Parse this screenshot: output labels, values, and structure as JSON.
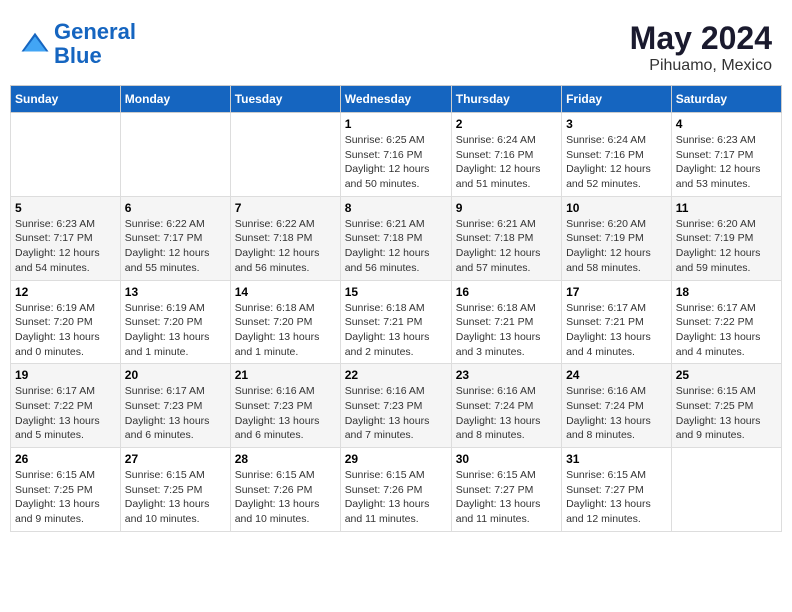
{
  "header": {
    "logo_line1": "General",
    "logo_line2": "Blue",
    "month_year": "May 2024",
    "location": "Pihuamo, Mexico"
  },
  "weekdays": [
    "Sunday",
    "Monday",
    "Tuesday",
    "Wednesday",
    "Thursday",
    "Friday",
    "Saturday"
  ],
  "weeks": [
    [
      {
        "day": "",
        "info": ""
      },
      {
        "day": "",
        "info": ""
      },
      {
        "day": "",
        "info": ""
      },
      {
        "day": "1",
        "info": "Sunrise: 6:25 AM\nSunset: 7:16 PM\nDaylight: 12 hours\nand 50 minutes."
      },
      {
        "day": "2",
        "info": "Sunrise: 6:24 AM\nSunset: 7:16 PM\nDaylight: 12 hours\nand 51 minutes."
      },
      {
        "day": "3",
        "info": "Sunrise: 6:24 AM\nSunset: 7:16 PM\nDaylight: 12 hours\nand 52 minutes."
      },
      {
        "day": "4",
        "info": "Sunrise: 6:23 AM\nSunset: 7:17 PM\nDaylight: 12 hours\nand 53 minutes."
      }
    ],
    [
      {
        "day": "5",
        "info": "Sunrise: 6:23 AM\nSunset: 7:17 PM\nDaylight: 12 hours\nand 54 minutes."
      },
      {
        "day": "6",
        "info": "Sunrise: 6:22 AM\nSunset: 7:17 PM\nDaylight: 12 hours\nand 55 minutes."
      },
      {
        "day": "7",
        "info": "Sunrise: 6:22 AM\nSunset: 7:18 PM\nDaylight: 12 hours\nand 56 minutes."
      },
      {
        "day": "8",
        "info": "Sunrise: 6:21 AM\nSunset: 7:18 PM\nDaylight: 12 hours\nand 56 minutes."
      },
      {
        "day": "9",
        "info": "Sunrise: 6:21 AM\nSunset: 7:18 PM\nDaylight: 12 hours\nand 57 minutes."
      },
      {
        "day": "10",
        "info": "Sunrise: 6:20 AM\nSunset: 7:19 PM\nDaylight: 12 hours\nand 58 minutes."
      },
      {
        "day": "11",
        "info": "Sunrise: 6:20 AM\nSunset: 7:19 PM\nDaylight: 12 hours\nand 59 minutes."
      }
    ],
    [
      {
        "day": "12",
        "info": "Sunrise: 6:19 AM\nSunset: 7:20 PM\nDaylight: 13 hours\nand 0 minutes."
      },
      {
        "day": "13",
        "info": "Sunrise: 6:19 AM\nSunset: 7:20 PM\nDaylight: 13 hours\nand 1 minute."
      },
      {
        "day": "14",
        "info": "Sunrise: 6:18 AM\nSunset: 7:20 PM\nDaylight: 13 hours\nand 1 minute."
      },
      {
        "day": "15",
        "info": "Sunrise: 6:18 AM\nSunset: 7:21 PM\nDaylight: 13 hours\nand 2 minutes."
      },
      {
        "day": "16",
        "info": "Sunrise: 6:18 AM\nSunset: 7:21 PM\nDaylight: 13 hours\nand 3 minutes."
      },
      {
        "day": "17",
        "info": "Sunrise: 6:17 AM\nSunset: 7:21 PM\nDaylight: 13 hours\nand 4 minutes."
      },
      {
        "day": "18",
        "info": "Sunrise: 6:17 AM\nSunset: 7:22 PM\nDaylight: 13 hours\nand 4 minutes."
      }
    ],
    [
      {
        "day": "19",
        "info": "Sunrise: 6:17 AM\nSunset: 7:22 PM\nDaylight: 13 hours\nand 5 minutes."
      },
      {
        "day": "20",
        "info": "Sunrise: 6:17 AM\nSunset: 7:23 PM\nDaylight: 13 hours\nand 6 minutes."
      },
      {
        "day": "21",
        "info": "Sunrise: 6:16 AM\nSunset: 7:23 PM\nDaylight: 13 hours\nand 6 minutes."
      },
      {
        "day": "22",
        "info": "Sunrise: 6:16 AM\nSunset: 7:23 PM\nDaylight: 13 hours\nand 7 minutes."
      },
      {
        "day": "23",
        "info": "Sunrise: 6:16 AM\nSunset: 7:24 PM\nDaylight: 13 hours\nand 8 minutes."
      },
      {
        "day": "24",
        "info": "Sunrise: 6:16 AM\nSunset: 7:24 PM\nDaylight: 13 hours\nand 8 minutes."
      },
      {
        "day": "25",
        "info": "Sunrise: 6:15 AM\nSunset: 7:25 PM\nDaylight: 13 hours\nand 9 minutes."
      }
    ],
    [
      {
        "day": "26",
        "info": "Sunrise: 6:15 AM\nSunset: 7:25 PM\nDaylight: 13 hours\nand 9 minutes."
      },
      {
        "day": "27",
        "info": "Sunrise: 6:15 AM\nSunset: 7:25 PM\nDaylight: 13 hours\nand 10 minutes."
      },
      {
        "day": "28",
        "info": "Sunrise: 6:15 AM\nSunset: 7:26 PM\nDaylight: 13 hours\nand 10 minutes."
      },
      {
        "day": "29",
        "info": "Sunrise: 6:15 AM\nSunset: 7:26 PM\nDaylight: 13 hours\nand 11 minutes."
      },
      {
        "day": "30",
        "info": "Sunrise: 6:15 AM\nSunset: 7:27 PM\nDaylight: 13 hours\nand 11 minutes."
      },
      {
        "day": "31",
        "info": "Sunrise: 6:15 AM\nSunset: 7:27 PM\nDaylight: 13 hours\nand 12 minutes."
      },
      {
        "day": "",
        "info": ""
      }
    ]
  ]
}
